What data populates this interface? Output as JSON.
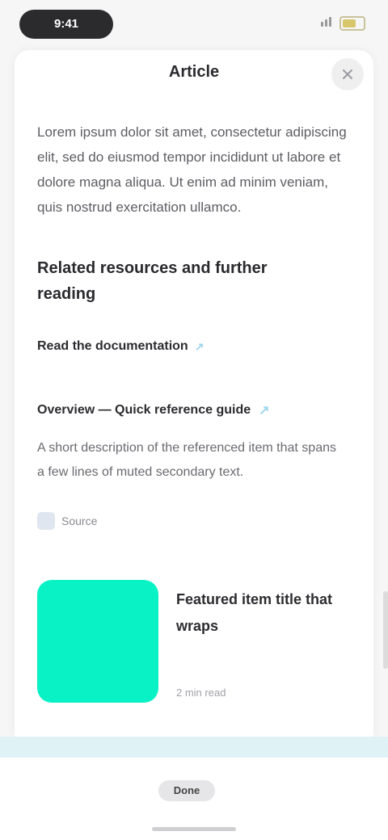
{
  "status_bar": {
    "time": "9:41"
  },
  "header": {
    "title": "Article"
  },
  "article": {
    "body": "Lorem ipsum dolor sit amet, consectetur adipiscing elit, sed do eiusmod tempor incididunt ut labore et dolore magna aliqua. Ut enim ad minim veniam, quis nostrud exercitation ullamco.",
    "section_title": "Related resources and further reading",
    "link_label": "Read the documentation",
    "subheading": "Overview — Quick reference guide",
    "description": "A short description of the referenced item that spans a few lines of muted secondary text.",
    "meta_label": "Source"
  },
  "card": {
    "title": "Featured item title that wraps",
    "meta": "2 min read",
    "thumb_color": "#08f2c6"
  },
  "bottom": {
    "button_label": "Done"
  },
  "colors": {
    "accent": "#08f2c6",
    "link_accent": "#9dd6ee",
    "band": "#dff3f7"
  }
}
